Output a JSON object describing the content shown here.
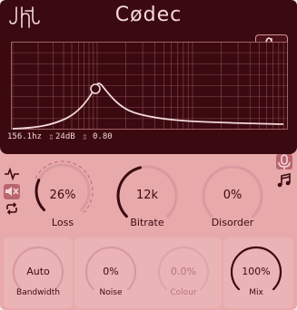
{
  "header": {
    "title": "Cødec"
  },
  "eq": {
    "freq": "156.1hz",
    "gain": "24dB",
    "q": "0.80"
  },
  "knobs": {
    "loss": {
      "value": "26%",
      "label": "Loss",
      "level": 0.26
    },
    "bitrate": {
      "value": "12k",
      "label": "Bitrate",
      "level": 0.45
    },
    "disorder": {
      "value": "0%",
      "label": "Disorder",
      "level": 0.0
    },
    "bandwidth": {
      "value": "Auto",
      "label": "Bandwidth",
      "level": 0.5
    },
    "noise": {
      "value": "0%",
      "label": "Noise",
      "level": 0.0
    },
    "colour": {
      "value": "0.0%",
      "label": "Colour",
      "level": 0.5
    },
    "mix": {
      "value": "100%",
      "label": "Mix",
      "level": 1.0
    }
  },
  "colors": {
    "background_dark": "#3b0a10",
    "panel": "#e8a9ab",
    "accent": "#f3d8d9",
    "knob_track": "#d48f95",
    "knob_fill": "#3b0a10"
  }
}
